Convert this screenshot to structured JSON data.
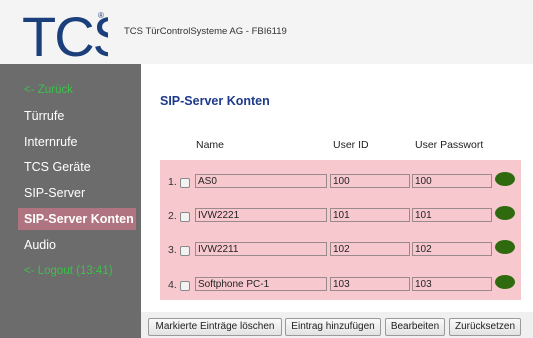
{
  "header": {
    "logo_text": "TCS",
    "title": "TCS TürControlSysteme AG - FBI6119"
  },
  "sidebar": {
    "items": [
      {
        "label": "<- Zurück"
      },
      {
        "label": "Türrufe"
      },
      {
        "label": "Internrufe"
      },
      {
        "label": "TCS Geräte"
      },
      {
        "label": "SIP-Server"
      },
      {
        "label": "SIP-Server Konten"
      },
      {
        "label": "Audio"
      },
      {
        "label": "<- Logout (13:41)"
      }
    ]
  },
  "main": {
    "title": "SIP-Server Konten",
    "columns": {
      "name": "Name",
      "user_id": "User ID",
      "password": "User Passwort"
    },
    "rows": [
      {
        "num": "1.",
        "name": "AS0",
        "user_id": "100",
        "password": "100"
      },
      {
        "num": "2.",
        "name": "IVW2221",
        "user_id": "101",
        "password": "101"
      },
      {
        "num": "3.",
        "name": "IVW2211",
        "user_id": "102",
        "password": "102"
      },
      {
        "num": "4.",
        "name": "Softphone PC-1",
        "user_id": "103",
        "password": "103"
      }
    ]
  },
  "buttons": {
    "delete_marked": "Markierte Einträge löschen",
    "add_entry": "Eintrag hinzufügen",
    "edit": "Bearbeiten",
    "reset": "Zurücksetzen"
  },
  "colors": {
    "sidebar_bg": "#6c6c6c",
    "active_item": "#b07480",
    "link_green": "#3cc24a",
    "table_bg": "#f7c9cf",
    "status_dot": "#2f6b0e",
    "title_blue": "#1e3a8a"
  }
}
